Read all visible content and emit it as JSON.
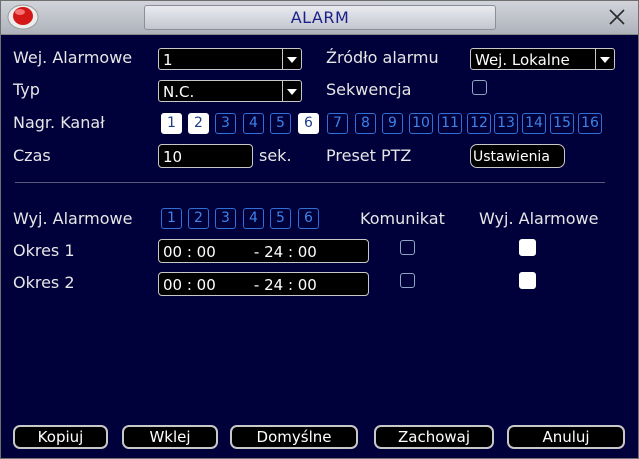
{
  "window": {
    "title": "ALARM"
  },
  "top": {
    "alarm_input": {
      "label": "Wej. Alarmowe",
      "value": "1"
    },
    "alarm_source": {
      "label": "Źródło alarmu",
      "value": "Wej. Lokalne"
    },
    "type": {
      "label": "Typ",
      "value": "N.C."
    },
    "sequence": {
      "label": "Sekwencja",
      "checked": false
    },
    "record_channel": {
      "label": "Nagr. Kanał",
      "channels": [
        {
          "n": "1",
          "on": true
        },
        {
          "n": "2",
          "on": true
        },
        {
          "n": "3",
          "on": false
        },
        {
          "n": "4",
          "on": false
        },
        {
          "n": "5",
          "on": false
        },
        {
          "n": "6",
          "on": true
        },
        {
          "n": "7",
          "on": false
        },
        {
          "n": "8",
          "on": false
        },
        {
          "n": "9",
          "on": false
        },
        {
          "n": "10",
          "on": false
        },
        {
          "n": "11",
          "on": false
        },
        {
          "n": "12",
          "on": false
        },
        {
          "n": "13",
          "on": false
        },
        {
          "n": "14",
          "on": false
        },
        {
          "n": "15",
          "on": false
        },
        {
          "n": "16",
          "on": false
        }
      ]
    },
    "time": {
      "label": "Czas",
      "value": "10",
      "unit": "sek."
    },
    "ptz": {
      "label": "Preset PTZ",
      "button": "Ustawienia"
    }
  },
  "bottom": {
    "alarm_output": {
      "label": "Wyj. Alarmowe",
      "outputs": [
        "1",
        "2",
        "3",
        "4",
        "5",
        "6"
      ]
    },
    "col_message": "Komunikat",
    "col_output": "Wyj. Alarmowe",
    "periods": [
      {
        "label": "Okres 1",
        "value": "00 : 00        - 24 : 00",
        "message": false,
        "output": true
      },
      {
        "label": "Okres 2",
        "value": "00 : 00        - 24 : 00",
        "message": false,
        "output": true
      }
    ]
  },
  "buttons": {
    "copy": "Kopiuj",
    "paste": "Wklej",
    "defaults": "Domyślne",
    "save": "Zachowaj",
    "cancel": "Anuluj"
  },
  "colors": {
    "background": "#00003b",
    "titlebar": "#c3c6cf",
    "title_text": "#1b1f8a",
    "channel_blue": "#2f6fd6"
  }
}
